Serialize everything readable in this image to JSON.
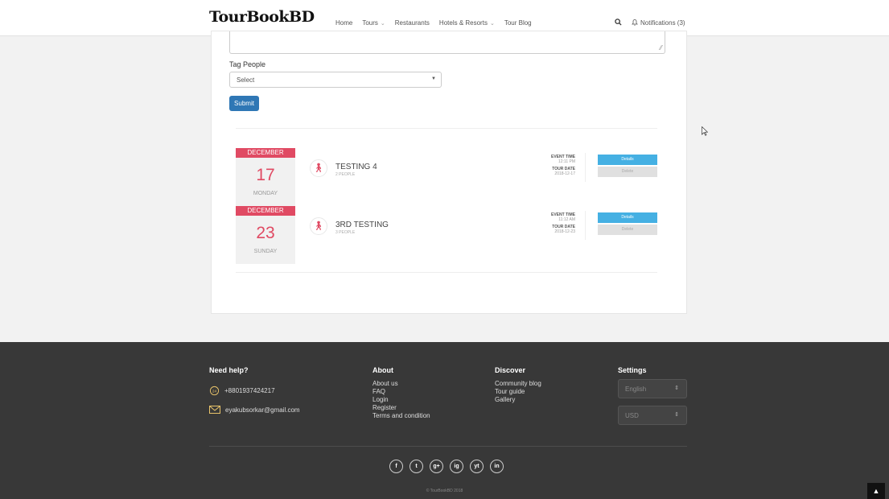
{
  "header": {
    "logo": "TourBookBD",
    "nav": [
      {
        "label": "Home",
        "dropdown": false
      },
      {
        "label": "Tours",
        "dropdown": true
      },
      {
        "label": "Restaurants",
        "dropdown": false
      },
      {
        "label": "Hotels & Resorts",
        "dropdown": true
      },
      {
        "label": "Tour Blog",
        "dropdown": false
      }
    ],
    "notifications_label": "Notifications (3)"
  },
  "form": {
    "tag_label": "Tag People",
    "select_value": "Select",
    "submit_label": "Submit"
  },
  "events": [
    {
      "month": "DECEMBER",
      "day": "17",
      "weekday": "MONDAY",
      "title": "TESTING 4",
      "people": "2 PEOPLE",
      "event_time_label": "EVENT TIME",
      "event_time": "12:11 PM",
      "tour_date_label": "TOUR DATE",
      "tour_date": "2018-12-17",
      "details_label": "Details",
      "delete_label": "Delete"
    },
    {
      "month": "DECEMBER",
      "day": "23",
      "weekday": "SUNDAY",
      "title": "3RD TESTING",
      "people": "3 PEOPLE",
      "event_time_label": "EVENT TIME",
      "event_time": "11:12 AM",
      "tour_date_label": "TOUR DATE",
      "tour_date": "2018-12-23",
      "details_label": "Details",
      "delete_label": "Delete"
    }
  ],
  "footer": {
    "need_help": {
      "heading": "Need help?",
      "phone": "+8801937424217",
      "email": "eyakubsorkar@gmail.com"
    },
    "about": {
      "heading": "About",
      "links": [
        "About us",
        "FAQ",
        "Login",
        "Register",
        "Terms and condition"
      ]
    },
    "discover": {
      "heading": "Discover",
      "links": [
        "Community blog",
        "Tour guide",
        "Gallery"
      ]
    },
    "settings": {
      "heading": "Settings",
      "language": "English",
      "currency": "USD"
    },
    "socials": [
      "f",
      "t",
      "g+",
      "ig",
      "yt",
      "in"
    ],
    "copyright": "© TourBookBD 2018"
  },
  "colors": {
    "accent_red": "#e04a63",
    "primary_blue": "#2f77b5",
    "details_blue": "#45b0e3",
    "footer_bg": "#383838"
  }
}
